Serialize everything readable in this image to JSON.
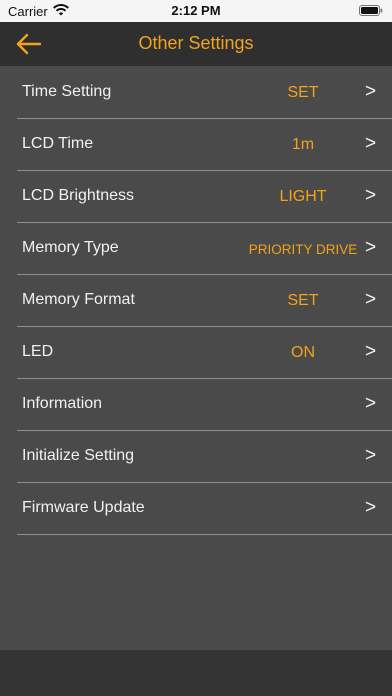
{
  "status_bar": {
    "carrier": "Carrier",
    "time": "2:12 PM"
  },
  "nav": {
    "title": "Other Settings",
    "back_icon": "back-arrow-icon"
  },
  "settings": [
    {
      "label": "Time Setting",
      "value": "SET"
    },
    {
      "label": "LCD Time",
      "value": "1m"
    },
    {
      "label": "LCD Brightness",
      "value": "LIGHT"
    },
    {
      "label": "Memory Type",
      "value": "PRIORITY DRIVE"
    },
    {
      "label": "Memory Format",
      "value": "SET"
    },
    {
      "label": "LED",
      "value": "ON"
    },
    {
      "label": "Information",
      "value": ""
    },
    {
      "label": "Initialize Setting",
      "value": ""
    },
    {
      "label": "Firmware Update",
      "value": ""
    }
  ],
  "chevron_text": ">",
  "colors": {
    "accent": "#f2a21b",
    "background": "#4a4a4a",
    "nav_background": "#2f2f2f",
    "divider": "#8e8e8e"
  }
}
